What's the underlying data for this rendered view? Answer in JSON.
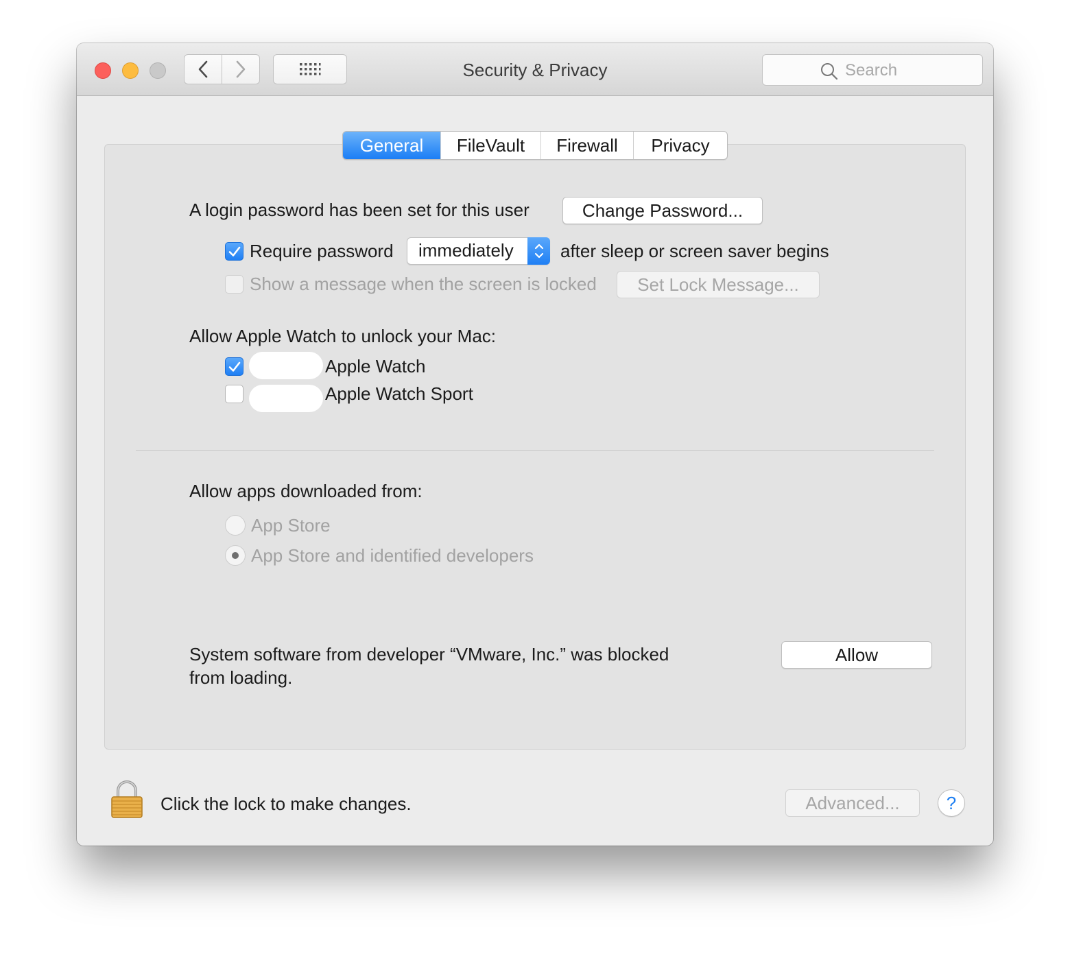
{
  "window": {
    "title": "Security & Privacy",
    "search_placeholder": "Search",
    "traffic_lights": [
      "close",
      "minimize",
      "zoom-disabled"
    ]
  },
  "tabs": [
    {
      "label": "General",
      "active": true
    },
    {
      "label": "FileVault",
      "active": false
    },
    {
      "label": "Firewall",
      "active": false
    },
    {
      "label": "Privacy",
      "active": false
    }
  ],
  "general": {
    "login_text": "A login password has been set for this user",
    "change_password_label": "Change Password...",
    "require_password": {
      "label": "Require password",
      "checked": true,
      "selected_option": "immediately",
      "suffix": "after sleep or screen saver begins"
    },
    "lock_message": {
      "label": "Show a message when the screen is locked",
      "checked": false,
      "button_label": "Set Lock Message..."
    },
    "apple_watch": {
      "heading": "Allow Apple Watch to unlock your Mac:",
      "items": [
        {
          "label": "Apple Watch",
          "checked": true
        },
        {
          "label": "Apple Watch Sport",
          "checked": false
        }
      ]
    },
    "downloads": {
      "heading": "Allow apps downloaded from:",
      "options": [
        {
          "label": "App Store",
          "selected": false
        },
        {
          "label": "App Store and identified developers",
          "selected": true
        }
      ]
    },
    "blocked": {
      "line1": "System software from developer “VMware, Inc.” was blocked",
      "line2": "from loading.",
      "allow_label": "Allow"
    }
  },
  "footer": {
    "lock_text": "Click the lock to make changes.",
    "advanced_label": "Advanced...",
    "help_label": "?"
  },
  "colors": {
    "accent_blue": "#1f7ff4",
    "close_red": "#fc605c",
    "minimize_yellow": "#fdbc40",
    "zoom_gray": "#c9c9c9"
  }
}
